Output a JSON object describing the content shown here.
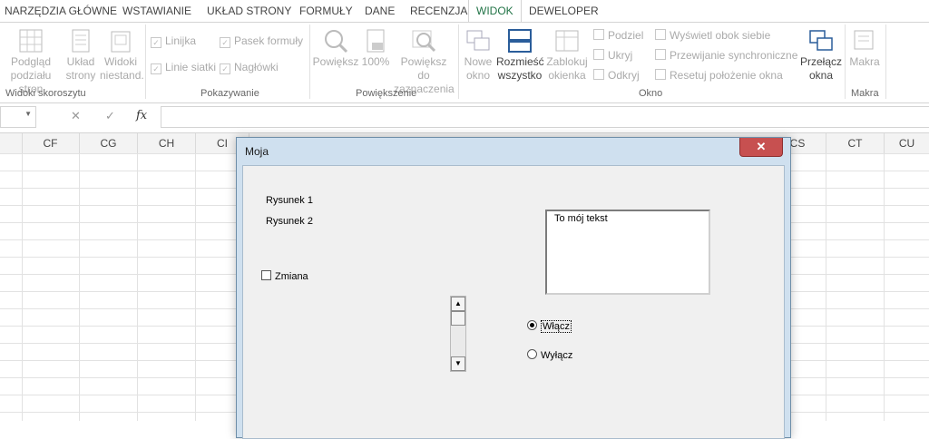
{
  "ribbon_tabs": [
    "NARZĘDZIA GŁÓWNE",
    "WSTAWIANIE",
    "UKŁAD STRONY",
    "FORMUŁY",
    "DANE",
    "RECENZJA",
    "WIDOK",
    "DEWELOPER"
  ],
  "active_tab": "WIDOK",
  "ribbon": {
    "views": {
      "page_break": "Podgląd\npodziału stron",
      "page_layout": "Układ\nstrony",
      "custom_views": "Widoki\nniestand.",
      "group_label": "Widoki skoroszytu"
    },
    "show": {
      "ruler": "Linijka",
      "formula_bar": "Pasek formuły",
      "gridlines": "Linie siatki",
      "headings": "Nagłówki",
      "group_label": "Pokazywanie"
    },
    "zoom": {
      "zoom": "Powiększ",
      "zoom100": "100%",
      "zoom_selection": "Powiększ do\nzaznaczenia",
      "group_label": "Powiększenie"
    },
    "window": {
      "new_window": "Nowe\nokno",
      "arrange_all": "Rozmieść\nwszystko",
      "freeze": "Zablokuj\nokienka",
      "split": "Podziel",
      "hide": "Ukryj",
      "unhide": "Odkryj",
      "side_by_side": "Wyświetl obok siebie",
      "sync_scroll": "Przewijanie synchroniczne",
      "reset_pos": "Resetuj położenie okna",
      "switch": "Przełącz\nokna",
      "group_label": "Okno"
    },
    "macros": {
      "macros": "Makra",
      "group_label": "Makra"
    }
  },
  "formula_bar": {
    "fx": "fx",
    "cancel": "✕",
    "enter": "✓",
    "value": ""
  },
  "columns": [
    "CF",
    "CG",
    "CH",
    "CI",
    "CS",
    "CT",
    "CU"
  ],
  "dialog": {
    "title": "Moja",
    "close": "✕",
    "label1": "Rysunek 1",
    "label2": "Rysunek 2",
    "checkbox": "Zmiana",
    "textbox": "To mój tekst",
    "radio_on": "Włącz",
    "radio_off": "Wyłącz"
  },
  "colors": {
    "accent": "#217346",
    "dialog_frame": "#cfe0ef",
    "close_red": "#c75050"
  }
}
